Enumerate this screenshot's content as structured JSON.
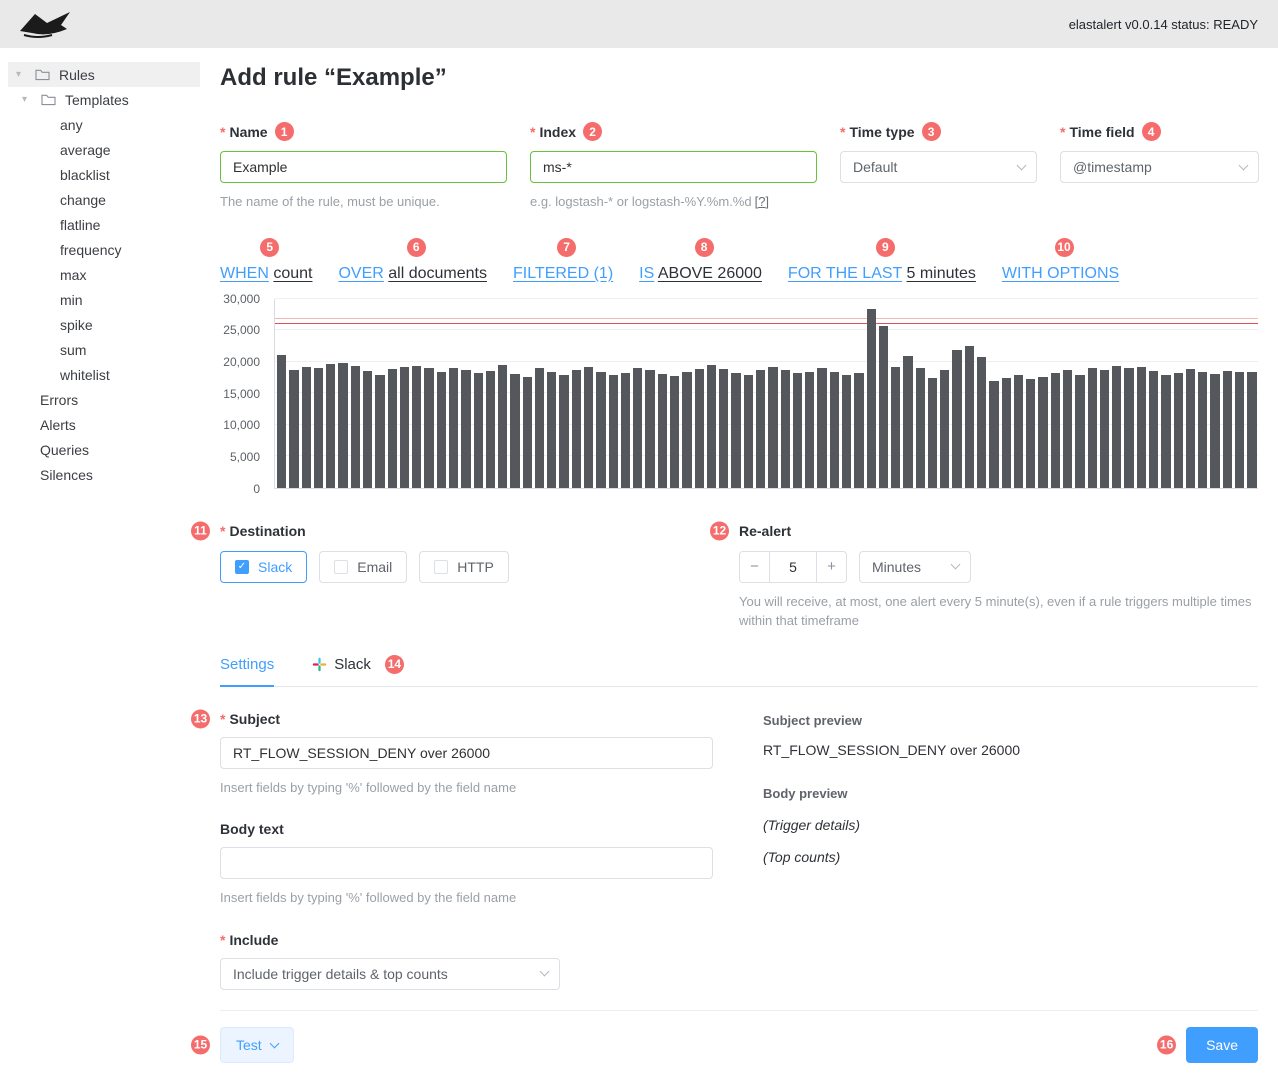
{
  "ui": {
    "required_marker": "*",
    "accent_color": "#409eff",
    "success_color": "#67c23a",
    "badge_color": "#f56c6c"
  },
  "topbar": {
    "status": "elastalert v0.0.14 status: READY"
  },
  "sidebar": {
    "rules_label": "Rules",
    "templates_label": "Templates",
    "template_items": [
      "any",
      "average",
      "blacklist",
      "change",
      "flatline",
      "frequency",
      "max",
      "min",
      "spike",
      "sum",
      "whitelist"
    ],
    "bottom_items": [
      "Errors",
      "Alerts",
      "Queries",
      "Silences"
    ]
  },
  "page": {
    "title": "Add rule “Example”"
  },
  "fields": {
    "name": {
      "label": "Name",
      "badge": "1",
      "value": "Example",
      "help": "The name of the rule, must be unique."
    },
    "index": {
      "label": "Index",
      "badge": "2",
      "value": "ms-*",
      "help": "e.g. logstash-* or logstash-%Y.%m.%d",
      "help_link": "[?]"
    },
    "time_type": {
      "label": "Time type",
      "badge": "3",
      "value": "Default"
    },
    "time_field": {
      "label": "Time field",
      "badge": "4",
      "value": "@timestamp"
    }
  },
  "query_builder": {
    "segments": [
      {
        "badge": "5",
        "blue": "WHEN",
        "dark": "count"
      },
      {
        "badge": "6",
        "blue": "OVER",
        "dark": "all documents"
      },
      {
        "badge": "7",
        "blue": "FILTERED (1)",
        "dark": ""
      },
      {
        "badge": "8",
        "blue": "IS",
        "dark": "ABOVE 26000"
      },
      {
        "badge": "9",
        "blue": "FOR THE LAST",
        "dark": "5 minutes"
      },
      {
        "badge": "10",
        "blue": "WITH OPTIONS",
        "dark": ""
      }
    ]
  },
  "chart_data": {
    "type": "bar",
    "title": "",
    "xlabel": "",
    "ylabel": "",
    "ylim": [
      0,
      30000
    ],
    "yticks": [
      30000,
      25000,
      20000,
      15000,
      10000,
      5000,
      0
    ],
    "ytick_labels": [
      "30,000",
      "25,000",
      "20,000",
      "15,000",
      "10,000",
      "5,000",
      "0"
    ],
    "grid": true,
    "bar_color": "#54585d",
    "threshold_lines": [
      {
        "value": 26800,
        "color": "#f2b8b8"
      },
      {
        "value": 26000,
        "color": "#e05252"
      }
    ],
    "values": [
      21000,
      18600,
      19100,
      18900,
      19600,
      19700,
      19300,
      18500,
      17900,
      18800,
      19100,
      19300,
      18900,
      18400,
      19000,
      18600,
      18100,
      18500,
      19400,
      18000,
      17600,
      18900,
      18300,
      17900,
      18700,
      19100,
      18400,
      17800,
      18200,
      19000,
      18600,
      18000,
      17700,
      18300,
      18800,
      19500,
      18800,
      18200,
      17900,
      18600,
      19100,
      18600,
      18100,
      18400,
      18900,
      18300,
      17800,
      18200,
      28300,
      25600,
      19200,
      20800,
      19000,
      17400,
      18700,
      21900,
      22400,
      20700,
      16900,
      17400,
      17800,
      17200,
      17500,
      18100,
      18600,
      17900,
      19000,
      18700,
      19300,
      18900,
      19100,
      18500,
      17800,
      18200,
      18800,
      18300,
      18000,
      18500,
      18300,
      18400
    ]
  },
  "destination": {
    "label": "Destination",
    "badge": "11",
    "options": [
      {
        "label": "Slack",
        "checked": true
      },
      {
        "label": "Email",
        "checked": false
      },
      {
        "label": "HTTP",
        "checked": false
      }
    ]
  },
  "realert": {
    "label": "Re-alert",
    "badge": "12",
    "minus": "−",
    "value": "5",
    "plus": "+",
    "unit": "Minutes",
    "help": "You will receive, at most, one alert every 5 minute(s), even if a rule triggers multiple times within that timeframe"
  },
  "tabs": {
    "settings": {
      "label": "Settings"
    },
    "slack": {
      "label": "Slack",
      "badge": "14"
    }
  },
  "settings_form": {
    "subject": {
      "label": "Subject",
      "badge": "13",
      "value": "RT_FLOW_SESSION_DENY over 26000",
      "help": "Insert fields by typing '%' followed by the field name"
    },
    "body": {
      "label": "Body text",
      "value": "",
      "help": "Insert fields by typing '%' followed by the field name"
    },
    "include": {
      "label": "Include",
      "value": "Include trigger details & top counts"
    }
  },
  "preview": {
    "subject_label": "Subject preview",
    "subject_value": "RT_FLOW_SESSION_DENY over 26000",
    "body_label": "Body preview",
    "body_lines": [
      "(Trigger details)",
      "(Top counts)"
    ]
  },
  "footer": {
    "test": {
      "label": "Test",
      "badge": "15"
    },
    "save": {
      "label": "Save",
      "badge": "16"
    }
  }
}
